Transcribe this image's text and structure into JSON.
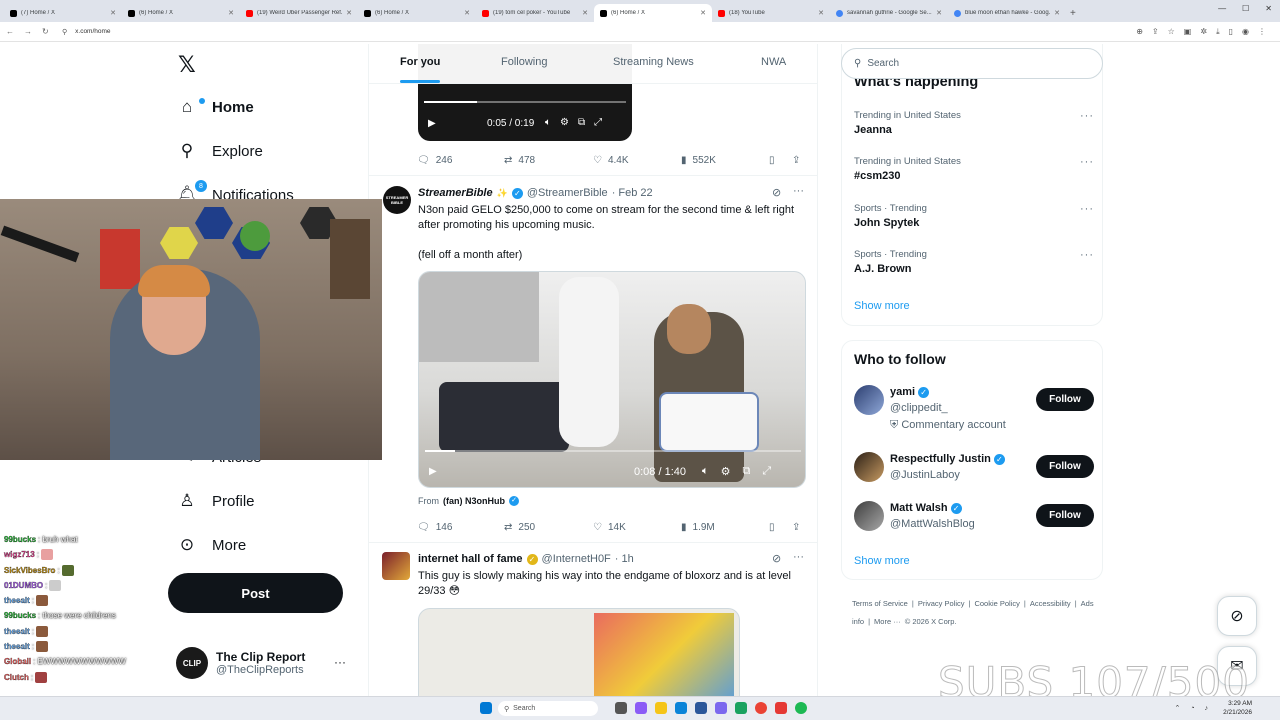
{
  "browser": {
    "tabs": [
      {
        "label": "(7) Home / X",
        "icon": "x"
      },
      {
        "label": "(6) Home / X",
        "icon": "x"
      },
      {
        "label": "(19) Weird Uber Passenger Ref...",
        "icon": "yt"
      },
      {
        "label": "(6) Home / X",
        "icon": "x"
      },
      {
        "label": "(19) tom cel poker - YouTube",
        "icon": "yt"
      },
      {
        "label": "(6) Home / X",
        "icon": "x",
        "active": true
      },
      {
        "label": "(18) YouTube",
        "icon": "yt"
      },
      {
        "label": "savannah guthrie - Google Se...",
        "icon": "g"
      },
      {
        "label": "blue moon ethan hawke - Goog...",
        "icon": "g"
      }
    ],
    "url": "x.com/home"
  },
  "nav": {
    "home": "Home",
    "explore": "Explore",
    "notifications": "Notifications",
    "notifications_badge": "8",
    "articles": "Articles",
    "profile": "Profile",
    "more": "More",
    "post": "Post",
    "account": {
      "name": "The Clip Report",
      "handle": "@TheClipReports",
      "avatar_text": "CLIP"
    }
  },
  "feed": {
    "tabs": [
      "For you",
      "Following",
      "Streaming News",
      "NWA"
    ],
    "top_video": {
      "time": "0:05 / 0:19",
      "progress": 0.26
    },
    "top_actions": {
      "replies": "246",
      "reposts": "478",
      "likes": "4.4K",
      "views": "552K"
    },
    "tweet1": {
      "name": "StreamerBible",
      "handle": "@StreamerBible",
      "date": "· Feb 22",
      "avatar_text": "STREAMER BIBLE",
      "line1": "N3on paid GELO $250,000 to come on stream for the second time & left right after promoting his upcoming music.",
      "line2": "(fell off a month after)",
      "video_time": "0:08 / 1:40",
      "video_progress": 0.08,
      "from_prefix": "From",
      "from_name": "(fan) N3onHub",
      "replies": "146",
      "reposts": "250",
      "likes": "14K",
      "views": "1.9M"
    },
    "tweet2": {
      "name": "internet hall of fame",
      "handle": "@InternetH0F",
      "date": "· 1h",
      "text": "This guy is slowly making his way into the endgame of bloxorz and is at level 29/33 😳"
    }
  },
  "sidebar": {
    "search_placeholder": "Search",
    "happening_title": "What's happening",
    "trends": [
      {
        "context": "Trending in United States",
        "topic": "Jeanna"
      },
      {
        "context": "Trending in United States",
        "topic": "#csm230"
      },
      {
        "context": "Sports · Trending",
        "topic": "John Spytek"
      },
      {
        "context": "Sports · Trending",
        "topic": "A.J. Brown"
      }
    ],
    "show_more": "Show more",
    "who_title": "Who to follow",
    "who": [
      {
        "name": "yami",
        "handle": "@clippedit_",
        "extra": "Commentary account",
        "follow": "Follow"
      },
      {
        "name": "Respectfully Justin",
        "handle": "@JustinLaboy",
        "follow": "Follow"
      },
      {
        "name": "Matt Walsh",
        "handle": "@MattWalshBlog",
        "follow": "Follow"
      }
    ],
    "footer": [
      "Terms of Service",
      "|",
      "Privacy Policy",
      "|",
      "Cookie Policy",
      "|",
      "Accessibility",
      "|",
      "Ads info",
      "|",
      "More ···",
      "© 2026 X Corp."
    ]
  },
  "chat": [
    {
      "user": "99bucks",
      "color": "#2ecc40",
      "msg": ": bruh what"
    },
    {
      "user": "wigz713",
      "color": "#ff4fa3",
      "msg": ":",
      "emote": "#e8a0a0"
    },
    {
      "user": "SickVibesBro",
      "color": "#d4a017",
      "msg": ":",
      "emote": "#556b2f"
    },
    {
      "user": "01DUMBO",
      "color": "#b86bff",
      "msg": ":",
      "emote": "#cccccc"
    },
    {
      "user": "theealt",
      "color": "#6fb7ff",
      "msg": ":",
      "emote": "#8b5a3c"
    },
    {
      "user": "99bucks",
      "color": "#2ecc40",
      "msg": ": those were childrens"
    },
    {
      "user": "theealt",
      "color": "#6fb7ff",
      "msg": ":",
      "emote": "#8b5a3c"
    },
    {
      "user": "theealt",
      "color": "#6fb7ff",
      "msg": ":",
      "emote": "#8b5a3c"
    },
    {
      "user": "Globall",
      "color": "#ff6b6b",
      "msg": ": EWWWWWWWWWWW"
    },
    {
      "user": "Clutch",
      "color": "#ff6b6b",
      "msg": ":",
      "emote": "#a04040"
    }
  ],
  "overlay": {
    "subs": "SUBS 107/500"
  },
  "taskbar": {
    "search": "Search",
    "time": "3:29 AM",
    "date": "2/21/2026"
  }
}
